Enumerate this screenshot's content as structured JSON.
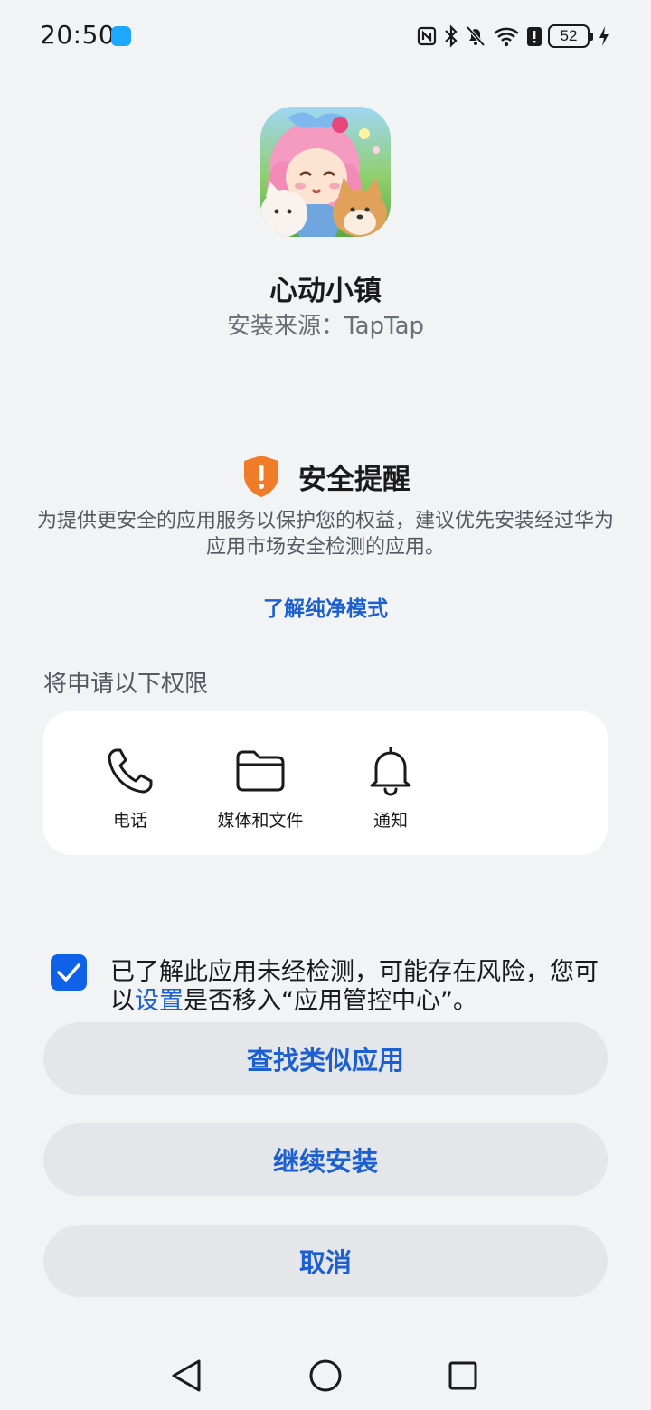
{
  "status_bar": {
    "time": "20:50",
    "battery": "52"
  },
  "app": {
    "name": "心动小镇",
    "install_source": "安装来源：TapTap"
  },
  "security": {
    "title": "安全提醒",
    "description": "为提供更安全的应用服务以保护您的权益，建议优先安装经过华为应用市场安全检测的应用。",
    "learn_link": "了解纯净模式"
  },
  "permissions": {
    "heading": "将申请以下权限",
    "items": [
      {
        "label": "电话",
        "icon": "phone-icon"
      },
      {
        "label": "媒体和文件",
        "icon": "folder-icon"
      },
      {
        "label": "通知",
        "icon": "bell-icon"
      }
    ]
  },
  "acknowledge": {
    "checked": true,
    "text_before": "已了解此应用未经检测，可能存在风险，您可以",
    "link": "设置",
    "text_after": "是否移入“应用管控中心”。"
  },
  "buttons": {
    "find_similar": "查找类似应用",
    "continue_install": "继续安装",
    "cancel": "取消"
  },
  "colors": {
    "accent": "#1b5fd1",
    "checkbox": "#0f62e8",
    "warning": "#f07b28",
    "background": "#f1f3f5"
  }
}
